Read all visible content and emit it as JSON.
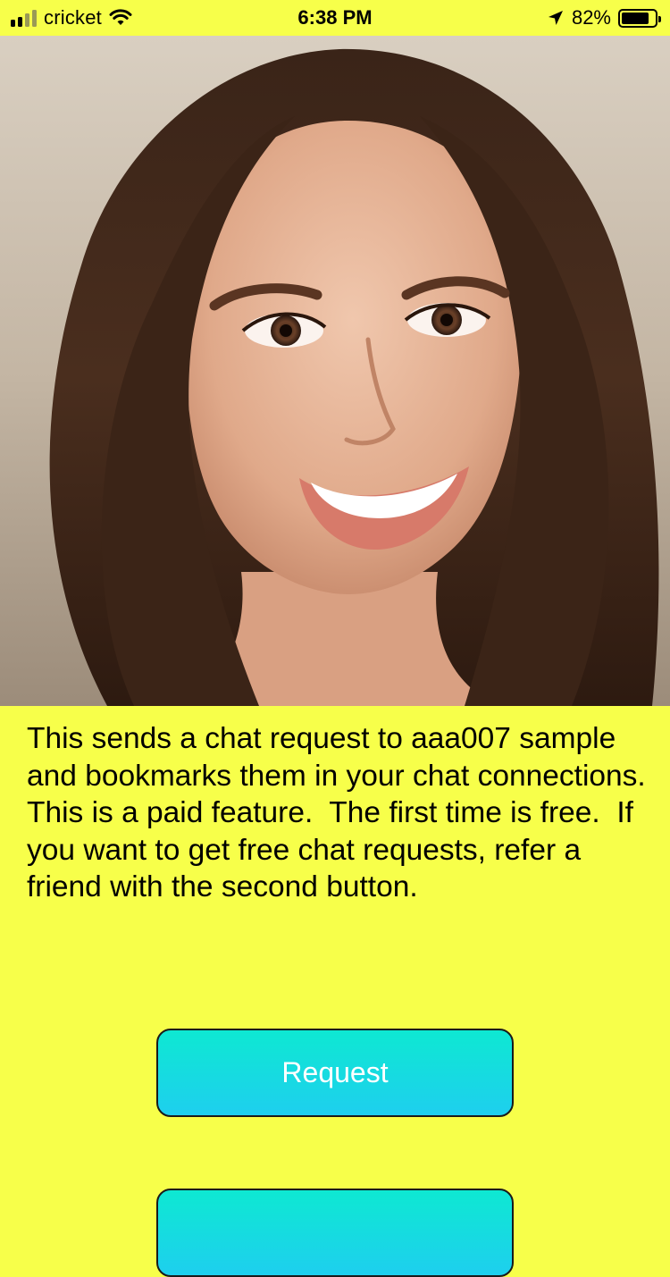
{
  "status_bar": {
    "carrier": "cricket",
    "time": "6:38 PM",
    "battery_percent": "82%",
    "battery_level": 0.82,
    "signal_bars_filled": 2,
    "signal_bars_total": 4,
    "icons": [
      "signal-icon",
      "wifi-icon",
      "location-arrow-icon",
      "battery-icon"
    ]
  },
  "profile": {
    "photo": "profile-photo"
  },
  "description": {
    "text": "This sends a chat request to aaa007 sample and bookmarks them in your chat connections.  This is a paid feature.  The first time is free.  If you want to get free chat requests, refer a friend with the second button."
  },
  "buttons": {
    "request_label": "Request"
  },
  "colors": {
    "background": "#f7ff4a",
    "button_gradient_top": "#0ee8d2",
    "button_gradient_bottom": "#1ecfee",
    "button_text": "#ffffff"
  }
}
